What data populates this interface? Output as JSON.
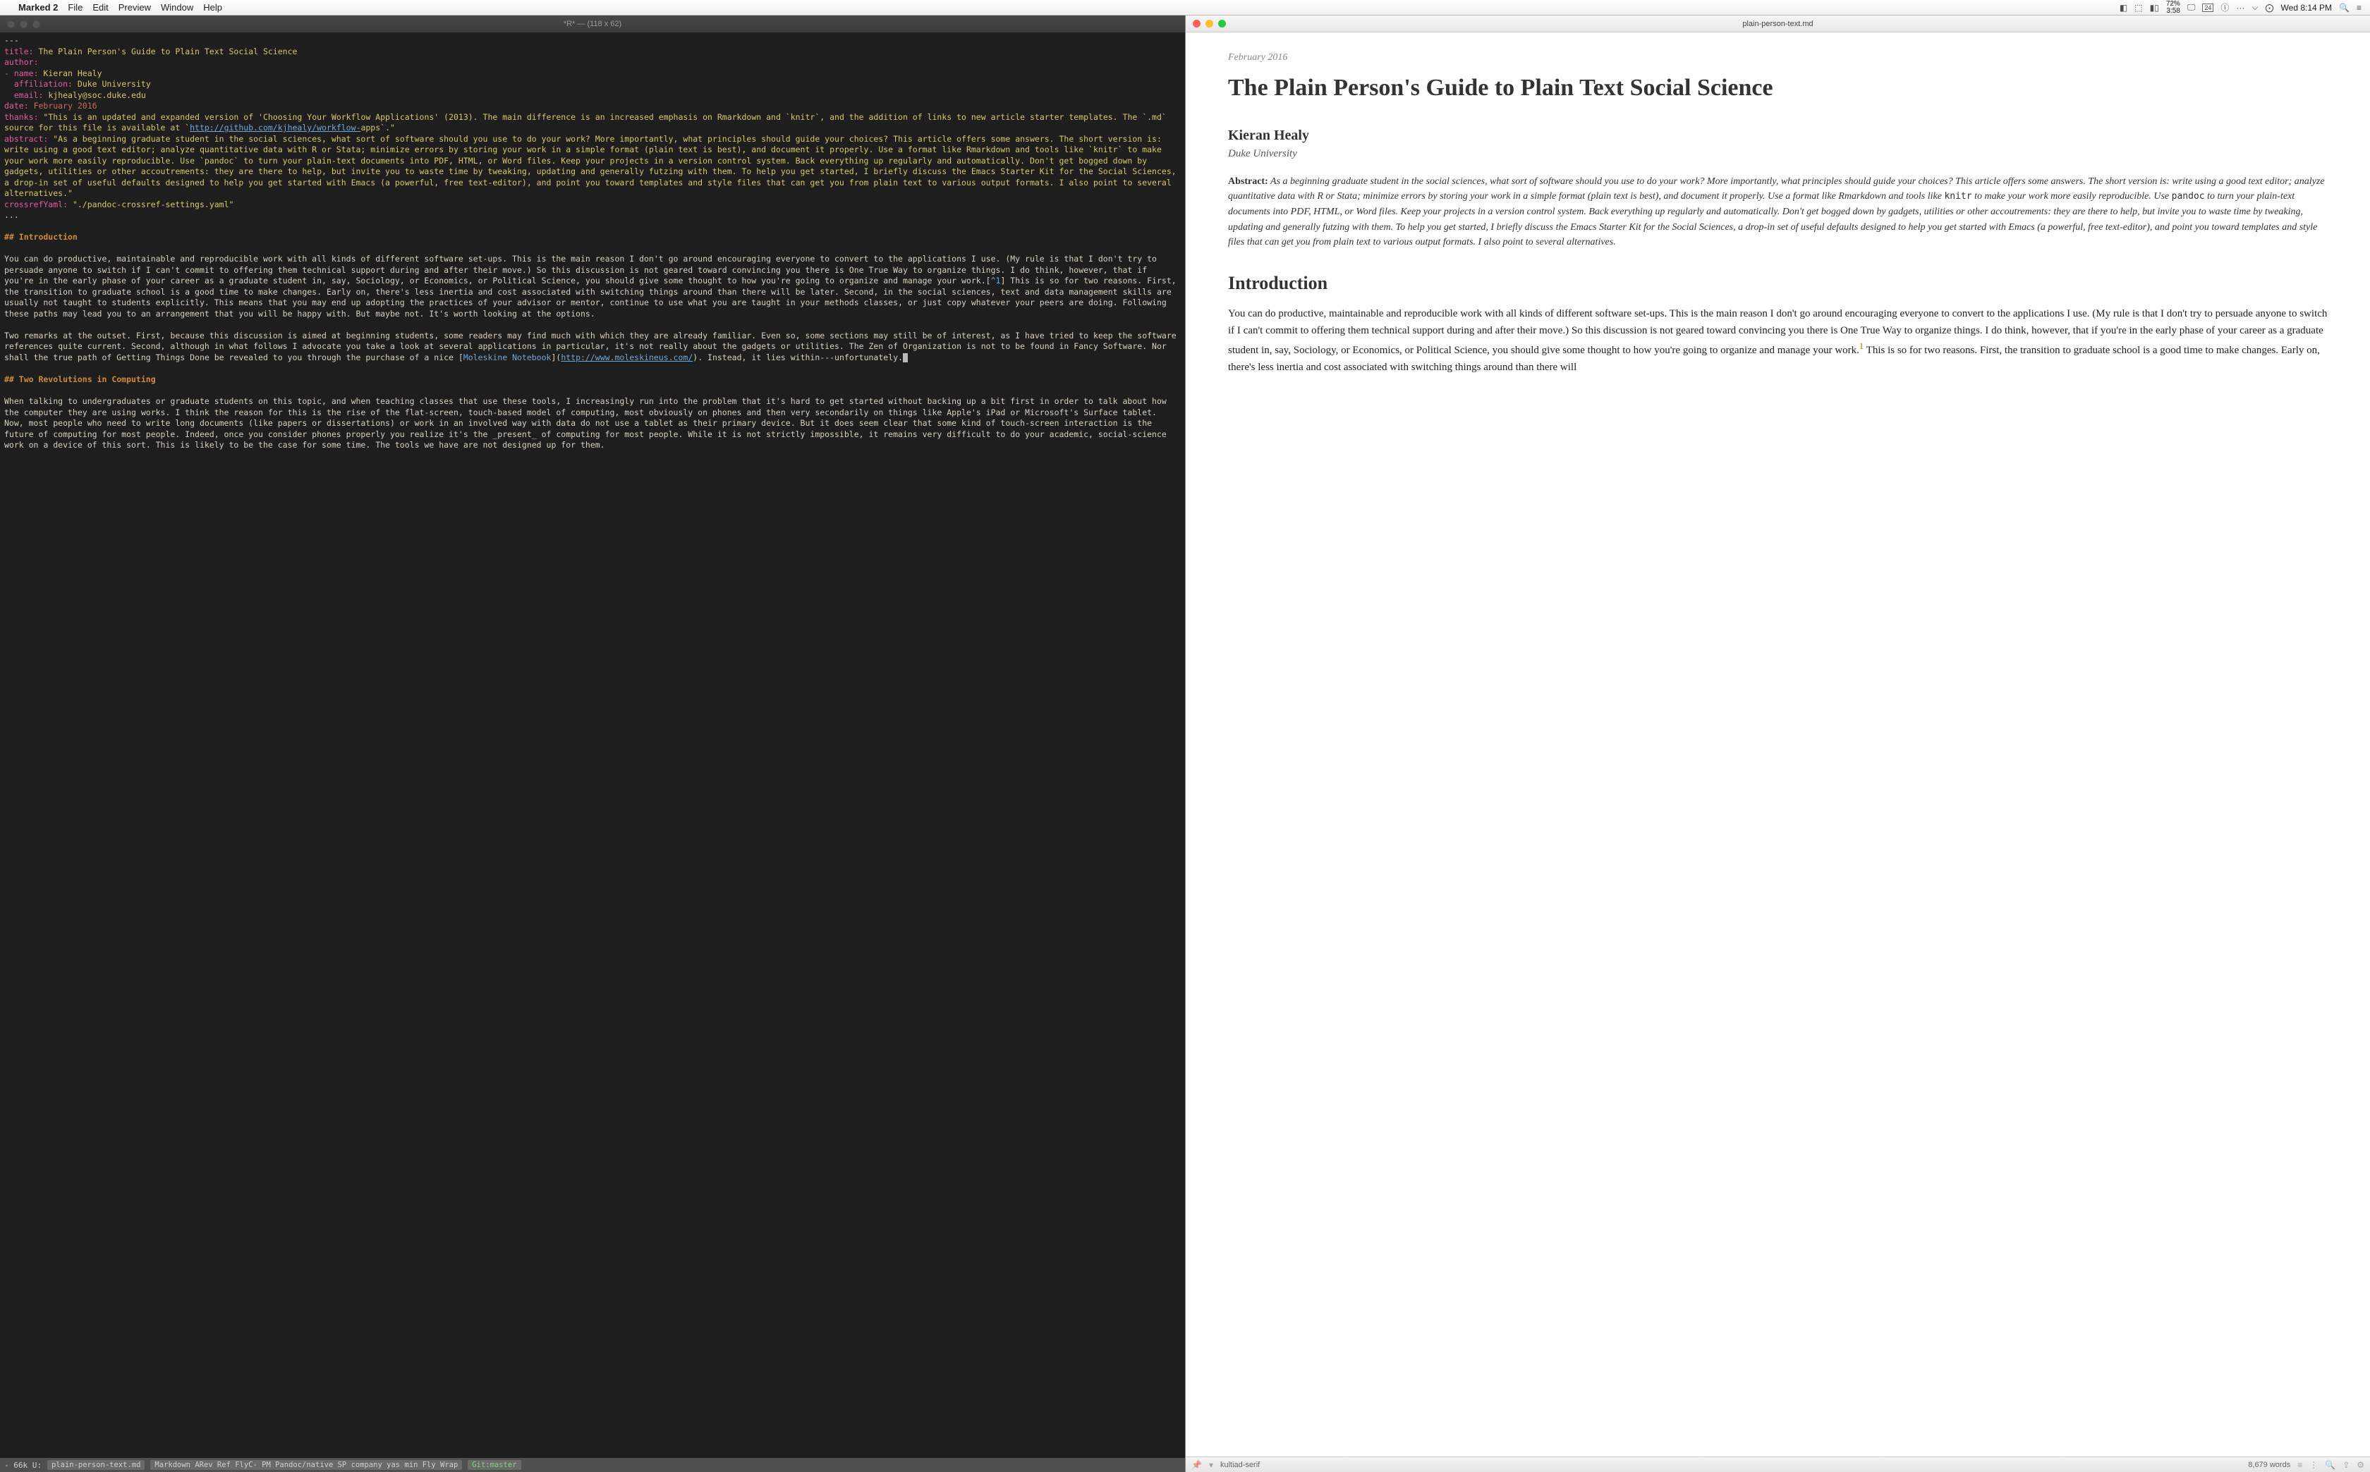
{
  "menubar": {
    "app": "Marked 2",
    "items": [
      "File",
      "Edit",
      "Preview",
      "Window",
      "Help"
    ],
    "battery_pct": "72%",
    "battery_time": "3:58",
    "date_badge": "24",
    "clock": "Wed 8:14 PM"
  },
  "emacs": {
    "title": "*R*  —  (118 x 62)",
    "yaml": {
      "dashes": "---",
      "title_key": "title:",
      "title_val": "The Plain Person's Guide to Plain Text Social Science",
      "author_key": "author:",
      "name_key": "- name:",
      "name_val": "Kieran Healy",
      "affiliation_key": "  affiliation:",
      "affiliation_val": "Duke University",
      "email_key": "  email:",
      "email_val": "kjhealy@soc.duke.edu",
      "date_key": "date:",
      "date_val": "February 2016",
      "thanks_key": "thanks:",
      "thanks_val_pre": "\"This is an updated and expanded version of 'Choosing Your Workflow Applications' (2013). The main difference is an increased emphasis on Rmarkdown and `knitr`, and the addition of links to new article starter templates. The `.md` source for this file is available at `",
      "thanks_url": "http://github.com/kjhealy/workflow-",
      "thanks_val_post": "apps`.\"",
      "abstract_key": "abstract:",
      "abstract_val": "\"As a beginning graduate student in the social sciences, what sort of software should you use to do your work? More importantly, what principles should guide your choices? This article offers some answers. The short version is: write using a good text editor; analyze quantitative data with R or Stata; minimize errors by storing your work in a simple format (plain text is best), and document it properly. Use a format like Rmarkdown and tools like `knitr` to make your work more easily reproducible. Use `pandoc` to turn your plain-text documents into PDF, HTML, or Word files. Keep your projects in a version control system. Back everything up regularly and automatically. Don't get bogged down by gadgets, utilities or other accoutrements: they are there to help, but invite you to waste time by tweaking, updating and generally futzing with them. To help you get started, I briefly discuss the Emacs Starter Kit for the Social Sciences, a drop-in set of useful defaults designed to help you get started with Emacs (a powerful, free text-editor), and point you toward templates and style files that can get you from plain text to various output formats. I also point to several alternatives.\"",
      "crossref_key": "crossrefYaml:",
      "crossref_val": "\"./pandoc-crossref-settings.yaml\"",
      "dashes2": "..."
    },
    "h_intro": "## Introduction",
    "p_intro1_pre": "You can do productive, maintainable and reproducible work with all kinds of different software set-ups. This is the main reason I don't go around encouraging everyone to convert to the applications I use. (My rule is that I don't try to persuade anyone to switch if I can't commit to offering them technical support during and after their move.) So this discussion is not geared toward convincing you there is One True Way to organize things. I do think, however, that if you're in the early phase of your career as a graduate student in, say, Sociology, or Economics, or Political Science, you should give some thought to how you're going to organize and manage your work.[",
    "p_intro1_fn": "^1",
    "p_intro1_post": "] This is so for two reasons. First, the transition to graduate school is a good time to make changes. Early on, there's less inertia and cost associated with switching things around than there will be later. Second, in the social sciences, text and data management skills are usually not taught to students explicitly. This means that you may end up adopting the practices of your advisor or mentor, continue to use what you are taught in your methods classes, or just copy whatever your peers are doing. Following these paths may lead you to an arrangement that you will be happy with. But maybe not. It's worth looking at the options.",
    "p_intro2_pre": "Two remarks at the outset. First, because this discussion is aimed at beginning students, some readers may find much with which they are already familiar. Even so, some sections may still be of interest, as I have tried to keep the software references quite current. Second, although in what follows I advocate you take a look at several applications in particular, it's not really about the gadgets or utilities. The Zen of Organization is not to be found in Fancy Software. Nor shall the true path of Getting Things Done be revealed to you through the purchase of a nice [",
    "p_intro2_link": "Moleskine Notebook",
    "p_intro2_url_open": "](",
    "p_intro2_url": "http://www.moleskineus.com/",
    "p_intro2_url_close": ")",
    "p_intro2_post": ". Instead, it lies within---unfortunately.",
    "h_two": "## Two Revolutions in Computing",
    "p_two": "When talking to undergraduates or graduate students on this topic, and when teaching classes that use these tools, I increasingly run into the problem that it's hard to get started without backing up a bit first in order to talk about how the computer they are using works. I think the reason for this is the rise of the flat-screen, touch-based model of computing, most obviously on phones and then very secondarily on things like Apple's iPad or Microsoft's Surface tablet. Now, most people who need to write long documents (like papers or dissertations) or work in an involved way with data do not use a tablet as their primary device. But it does seem clear that some kind of touch-screen interaction is the future of computing for most people. Indeed, once you consider phones properly you realize it's the _present_ of computing for most people. While it is not strictly impossible, it remains very difficult to do your academic, social-science work on a device of this sort. This is likely to be the case for some time. The tools we have are not designed up for them.",
    "modeline": {
      "left": "- 66k U:",
      "file": "plain-person-text.md",
      "mode": "Markdown ARev Ref FlyC- PM Pandoc/native SP company yas min Fly Wrap",
      "git": "Git:master"
    }
  },
  "marked": {
    "title": "plain-person-text.md",
    "date": "February 2016",
    "h1": "The Plain Person's Guide to Plain Text Social Science",
    "author": "Kieran Healy",
    "affil": "Duke University",
    "abstract_label": "Abstract:",
    "abstract_body_1": " As a beginning graduate student in the social sciences, what sort of software should you use to do your work? More importantly, what principles should guide your choices? This article offers some answers. The short version is: write using a good text editor; analyze quantitative data with R or Stata; minimize errors by storing your work in a simple format (plain text is best), and document it properly. Use a format like Rmarkdown and tools like ",
    "abstract_code1": "knitr",
    "abstract_body_2": " to make your work more easily reproducible. Use ",
    "abstract_code2": "pandoc",
    "abstract_body_3": " to turn your plain-text documents into PDF, HTML, or Word files. Keep your projects in a version control system. Back everything up regularly and automatically. Don't get bogged down by gadgets, utilities or other accoutrements: they are there to help, but invite you to waste time by tweaking, updating and generally futzing with them. To help you get started, I briefly discuss the Emacs Starter Kit for the Social Sciences, a drop-in set of useful defaults designed to help you get started with Emacs (a powerful, free text-editor), and point you toward templates and style files that can get you from plain text to various output formats. I also point to several alternatives.",
    "h2_intro": "Introduction",
    "p1_pre": "You can do productive, maintainable and reproducible work with all kinds of different software set-ups. This is the main reason I don't go around encouraging everyone to convert to the applications I use. (My rule is that I don't try to persuade anyone to switch if I can't commit to offering them technical support during and after their move.) So this discussion is not geared toward convincing you there is One True Way to organize things. I do think, however, that if you're in the early phase of your career as a graduate student in, say, Sociology, or Economics, or Political Science, you should give some thought to how you're going to organize and manage your work.",
    "p1_fn": "1",
    "p1_post": " This is so for two reasons. First, the transition to graduate school is a good time to make changes. Early on, there's less inertia and cost associated with switching things around than there will",
    "status": {
      "font": "kultiad-serif",
      "words": "8,679 words"
    }
  }
}
